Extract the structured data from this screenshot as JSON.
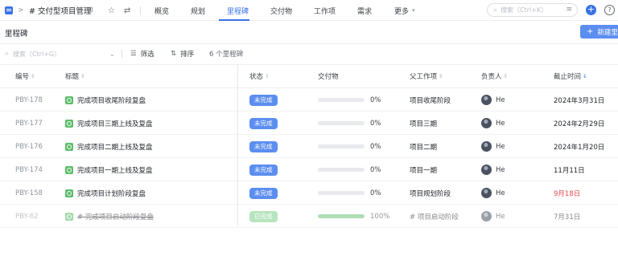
{
  "topnav": {
    "project_title": "# 交付型项目管理",
    "tabs": [
      {
        "label": "概览"
      },
      {
        "label": "规划"
      },
      {
        "label": "里程碑"
      },
      {
        "label": "交付物"
      },
      {
        "label": "工作项"
      },
      {
        "label": "需求"
      },
      {
        "label": "更多"
      }
    ],
    "active_tab": "里程碑",
    "search_placeholder": "搜索（Ctrl+K）"
  },
  "page": {
    "title": "里程碑",
    "new_button": "新建里程"
  },
  "filterbar": {
    "search_placeholder": "搜索（Ctrl+G）",
    "filter_label": "筛选",
    "sort_label": "排序",
    "count_text": "6 个里程碑"
  },
  "table": {
    "headers": {
      "id": "编号",
      "title": "标题",
      "status": "状态",
      "deliverable": "交付物",
      "parent": "父工作项",
      "owner": "负责人",
      "due": "截止时间"
    },
    "rows": [
      {
        "id": "PBY-178",
        "title": "完成项目收尾阶段复盘",
        "status": "未完成",
        "progress": 0,
        "pct": "0%",
        "parent": "项目收尾阶段",
        "owner": "He",
        "due": "2024年3月31日",
        "overdue": false,
        "done": false
      },
      {
        "id": "PBY-177",
        "title": "完成项目三期上线及复盘",
        "status": "未完成",
        "progress": 0,
        "pct": "0%",
        "parent": "项目三期",
        "owner": "He",
        "due": "2024年2月29日",
        "overdue": false,
        "done": false
      },
      {
        "id": "PBY-176",
        "title": "完成项目二期上线及复盘",
        "status": "未完成",
        "progress": 0,
        "pct": "0%",
        "parent": "项目二期",
        "owner": "He",
        "due": "2024年1月20日",
        "overdue": false,
        "done": false
      },
      {
        "id": "PBY-174",
        "title": "完成项目一期上线及复盘",
        "status": "未完成",
        "progress": 0,
        "pct": "0%",
        "parent": "项目一期",
        "owner": "He",
        "due": "11月11日",
        "overdue": false,
        "done": false
      },
      {
        "id": "PBY-158",
        "title": "完成项目计划阶段复盘",
        "status": "未完成",
        "progress": 0,
        "pct": "0%",
        "parent": "项目规划阶段",
        "owner": "He",
        "due": "9月18日",
        "overdue": true,
        "done": false
      },
      {
        "id": "PBY-62",
        "title": "# 完成项目启动阶段复盘",
        "status": "已完成",
        "progress": 100,
        "pct": "100%",
        "parent": "# 项目启动阶段",
        "owner": "He",
        "due": "7月31日",
        "overdue": false,
        "done": true
      }
    ]
  },
  "colors": {
    "accent": "#3a72e8",
    "badge_open": "#5b8ef0",
    "badge_done": "#7fcf8a",
    "overdue": "#e5484d",
    "milestone_icon": "#5dbd6a"
  }
}
